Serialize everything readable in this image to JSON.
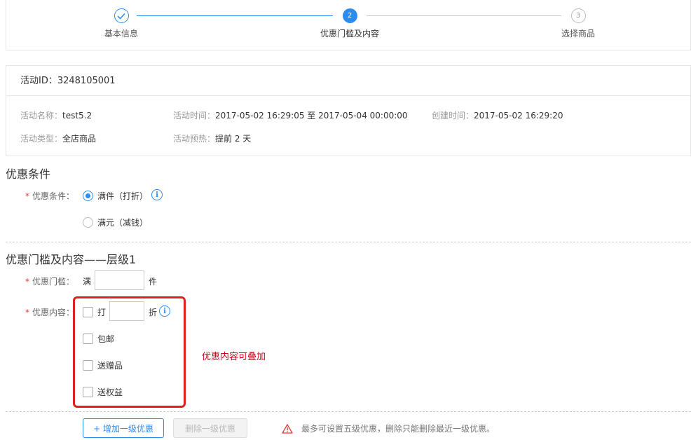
{
  "steps": [
    {
      "label": "基本信息",
      "state": "done"
    },
    {
      "label": "优惠门槛及内容",
      "state": "active",
      "number": "2"
    },
    {
      "label": "选择商品",
      "state": "todo",
      "number": "3"
    }
  ],
  "info": {
    "activity_id": "活动ID：3248105001",
    "name_label": "活动名称：",
    "name_value": "test5.2",
    "time_label": "活动时间：",
    "time_value": "2017-05-02 16:29:05 至 2017-05-04 00:00:00",
    "created_label": "创建时间：",
    "created_value": "2017-05-02 16:29:20",
    "type_label": "活动类型：",
    "type_value": "全店商品",
    "preheat_label": "活动预热：",
    "preheat_value": "提前 2 天"
  },
  "condition": {
    "section_title": "优惠条件",
    "label": "优惠条件：",
    "options": [
      {
        "label": "满件（打折）",
        "selected": true
      },
      {
        "label": "满元（减钱）",
        "selected": false
      }
    ]
  },
  "threshold": {
    "section_title": "优惠门槛及内容——层级1",
    "threshold_label": "优惠门槛：",
    "threshold_prefix": "满",
    "threshold_value": "",
    "threshold_suffix": "件",
    "content_label": "优惠内容：",
    "discount_prefix": "打",
    "discount_value": "",
    "discount_suffix": "折",
    "options": [
      "包邮",
      "送赠品",
      "送权益"
    ],
    "annotation": "优惠内容可叠加"
  },
  "actions": {
    "add_label": "+ 增加一级优惠",
    "remove_label": "删除一级优惠",
    "warning": "最多可设置五级优惠，删除只能删除最近一级优惠。"
  },
  "colors": {
    "accent": "#2d8cf0",
    "required": "#e4393c",
    "highlight": "#e02020",
    "annotation": "#d0021b"
  }
}
